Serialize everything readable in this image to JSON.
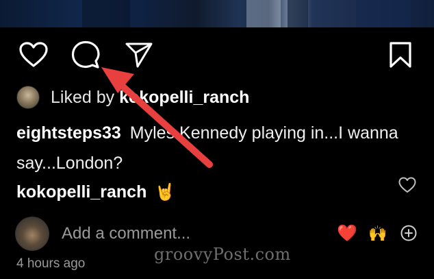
{
  "post": {
    "liked_by_prefix": "Liked by",
    "liked_by_user": "kokopelli_ranch",
    "caption_user": "eightsteps33",
    "caption_text": "Myles Kennedy playing in...I wanna say...London?",
    "comment_user": "kokopelli_ranch",
    "comment_emoji": "🤘",
    "add_comment_placeholder": "Add a comment...",
    "quick_reactions": [
      "❤️",
      "🙌"
    ],
    "timestamp": "4 hours ago"
  },
  "icons": {
    "like": "heart-icon",
    "comment": "speech-bubble-icon",
    "share": "paper-plane-icon",
    "save": "bookmark-icon",
    "comment_like": "small-heart-icon",
    "add_reaction": "plus-circle-icon"
  },
  "annotation": {
    "arrow_color": "#e8403f"
  },
  "watermark": "groovyPost.com"
}
